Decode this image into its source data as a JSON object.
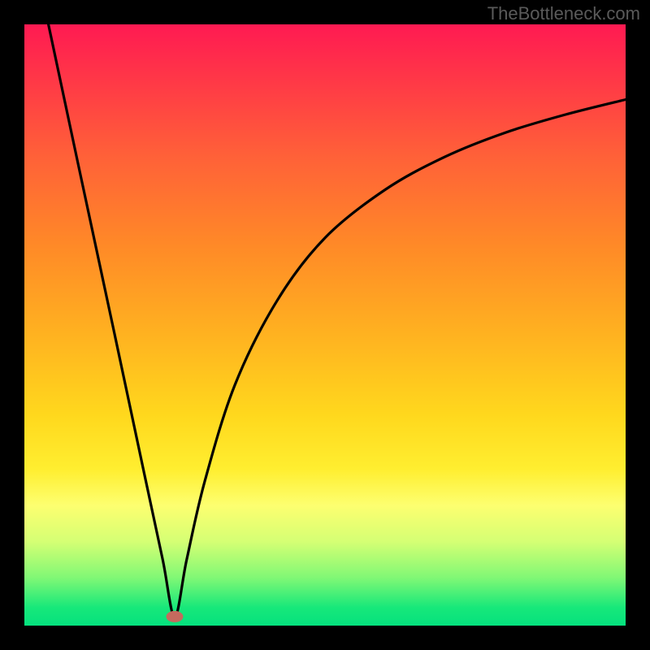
{
  "watermark": "TheBottleneck.com",
  "chart_data": {
    "type": "line",
    "title": "",
    "xlabel": "",
    "ylabel": "",
    "xlim": [
      0,
      100
    ],
    "ylim": [
      0,
      100
    ],
    "grid": false,
    "curve": {
      "minimum_x": 25.0,
      "minimum_y": 1.5,
      "points": [
        {
          "x": 4.0,
          "y": 100.0
        },
        {
          "x": 9.0,
          "y": 76.5
        },
        {
          "x": 15.0,
          "y": 48.5
        },
        {
          "x": 20.0,
          "y": 25.0
        },
        {
          "x": 23.0,
          "y": 11.0
        },
        {
          "x": 25.0,
          "y": 1.5
        },
        {
          "x": 27.0,
          "y": 11.0
        },
        {
          "x": 30.0,
          "y": 24.0
        },
        {
          "x": 35.0,
          "y": 40.0
        },
        {
          "x": 42.0,
          "y": 54.0
        },
        {
          "x": 50.0,
          "y": 64.5
        },
        {
          "x": 60.0,
          "y": 72.5
        },
        {
          "x": 70.0,
          "y": 78.0
        },
        {
          "x": 80.0,
          "y": 82.0
        },
        {
          "x": 90.0,
          "y": 85.0
        },
        {
          "x": 100.0,
          "y": 87.5
        }
      ]
    },
    "marker": {
      "x": 25.0,
      "y": 1.5,
      "color": "#c46a5e"
    },
    "gradient_stops": [
      {
        "pos": 0,
        "color": "#ff1a52"
      },
      {
        "pos": 10,
        "color": "#ff3a46"
      },
      {
        "pos": 22,
        "color": "#ff6138"
      },
      {
        "pos": 37,
        "color": "#ff8a27"
      },
      {
        "pos": 52,
        "color": "#ffb320"
      },
      {
        "pos": 65,
        "color": "#ffd81d"
      },
      {
        "pos": 74,
        "color": "#ffee30"
      },
      {
        "pos": 80,
        "color": "#fdff70"
      },
      {
        "pos": 86,
        "color": "#d5ff74"
      },
      {
        "pos": 92,
        "color": "#81f875"
      },
      {
        "pos": 97,
        "color": "#17e87a"
      },
      {
        "pos": 100,
        "color": "#05e17e"
      }
    ]
  }
}
